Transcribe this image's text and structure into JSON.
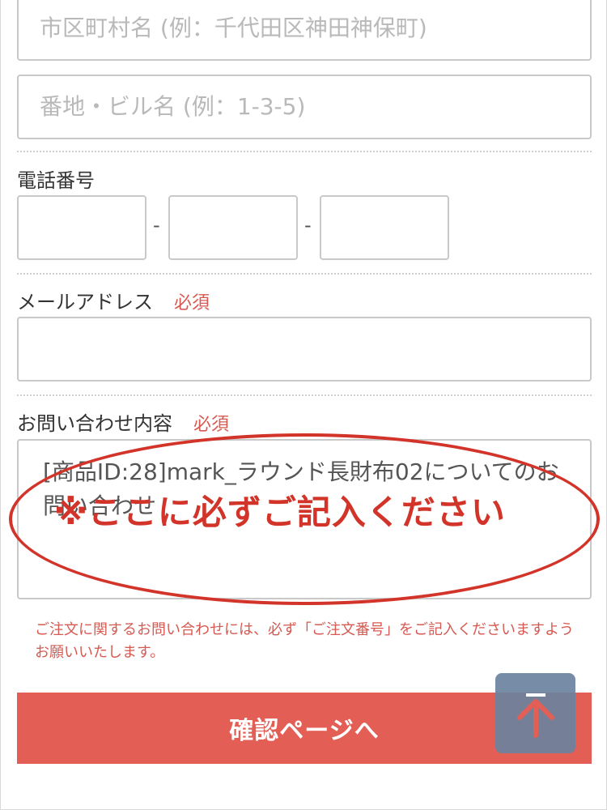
{
  "form": {
    "city_placeholder": "市区町村名 (例：千代田区神田神保町)",
    "street_placeholder": "番地・ビル名 (例：1-3-5)",
    "phone_label": "電話番号",
    "phone_separator": "-",
    "email_label": "メールアドレス",
    "email_required": "必須",
    "inquiry_label": "お問い合わせ内容",
    "inquiry_required": "必須",
    "inquiry_value": "[商品ID:28]mark_ラウンド長財布02についてのお問い合わせ",
    "note": "ご注文に関するお問い合わせには、必ず「ご注文番号」をご記入くださいますようお願いいたします。",
    "confirm_label": "確認ページへ"
  },
  "annotation": {
    "callout": "※ここに必ずご記入ください"
  },
  "icons": {
    "back_to_top": "arrow-up-icon"
  },
  "colors": {
    "accent_red": "#e35f55",
    "callout_red": "#d2342a",
    "required_red": "#d65a52",
    "scroll_button": "#6b829e"
  }
}
